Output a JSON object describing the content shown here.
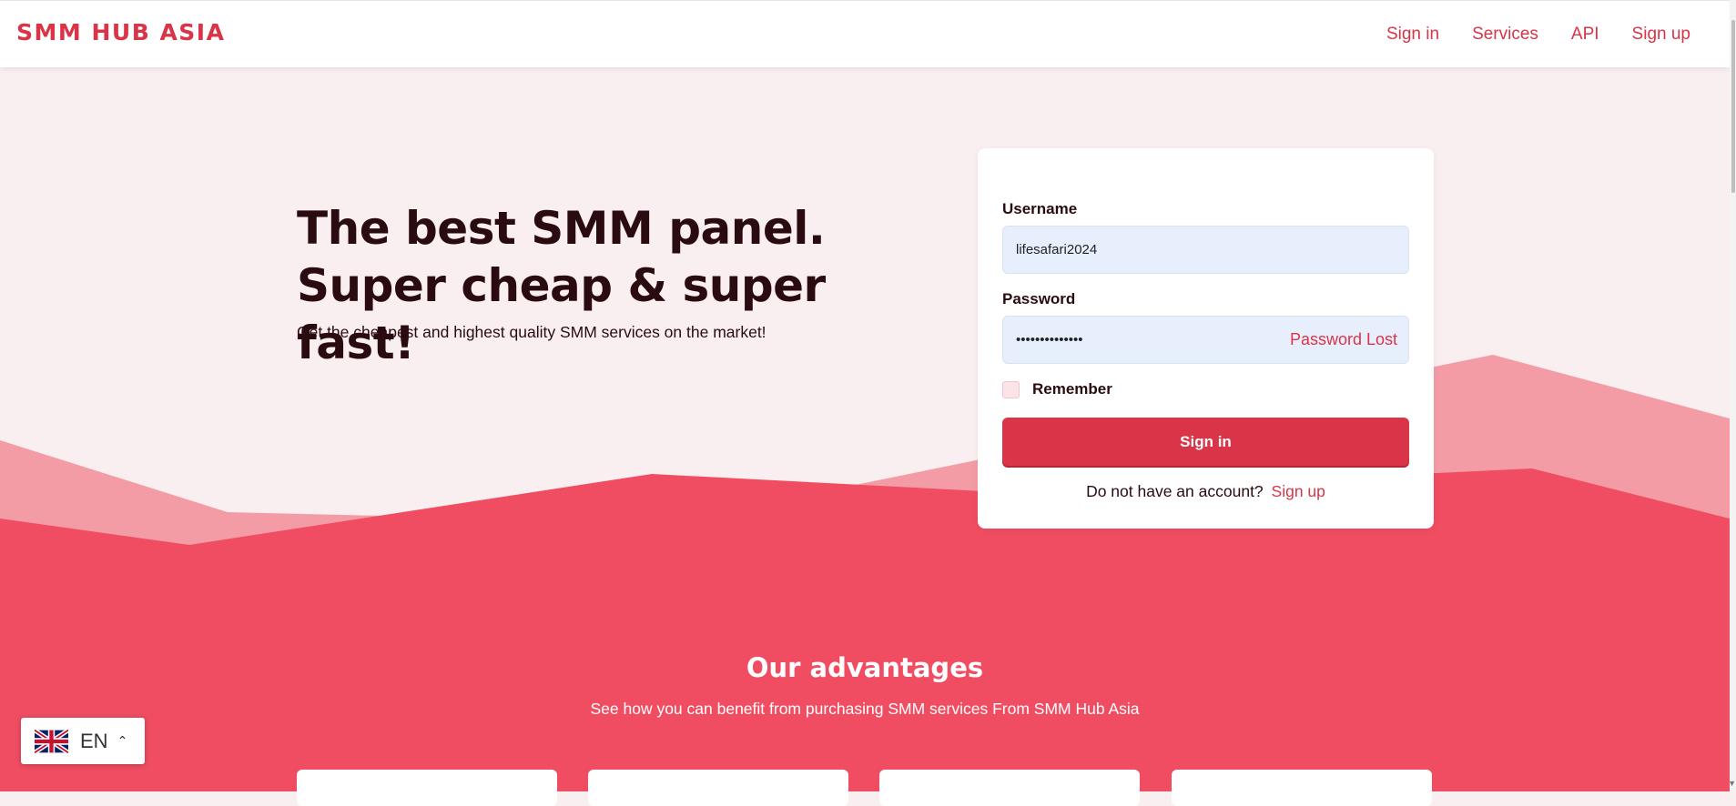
{
  "brand": "SMM HUB ASIA",
  "nav": {
    "signin": "Sign in",
    "services": "Services",
    "api": "API",
    "signup": "Sign up"
  },
  "hero": {
    "title": "The best SMM panel. Super cheap & super fast!",
    "subtitle": "Get the cheapest and highest quality SMM services on the market!"
  },
  "login": {
    "username_label": "Username",
    "username_value": "lifesafari2024",
    "password_label": "Password",
    "password_value": "••••••••••••••",
    "password_lost": "Password Lost",
    "remember_label": "Remember",
    "signin_button": "Sign in",
    "no_account_text": "Do not have an account?",
    "signup_link": "Sign up"
  },
  "advantages": {
    "title": "Our advantages",
    "subtitle": "See how you can benefit from purchasing SMM services From SMM Hub Asia"
  },
  "language": {
    "code": "EN",
    "flag_icon": "uk-flag-icon"
  },
  "colors": {
    "accent": "#d93447",
    "wave_light": "#f49ca6",
    "wave_dark": "#f04d62",
    "hero_bg": "#f9eff0",
    "input_bg": "#e8effc"
  }
}
